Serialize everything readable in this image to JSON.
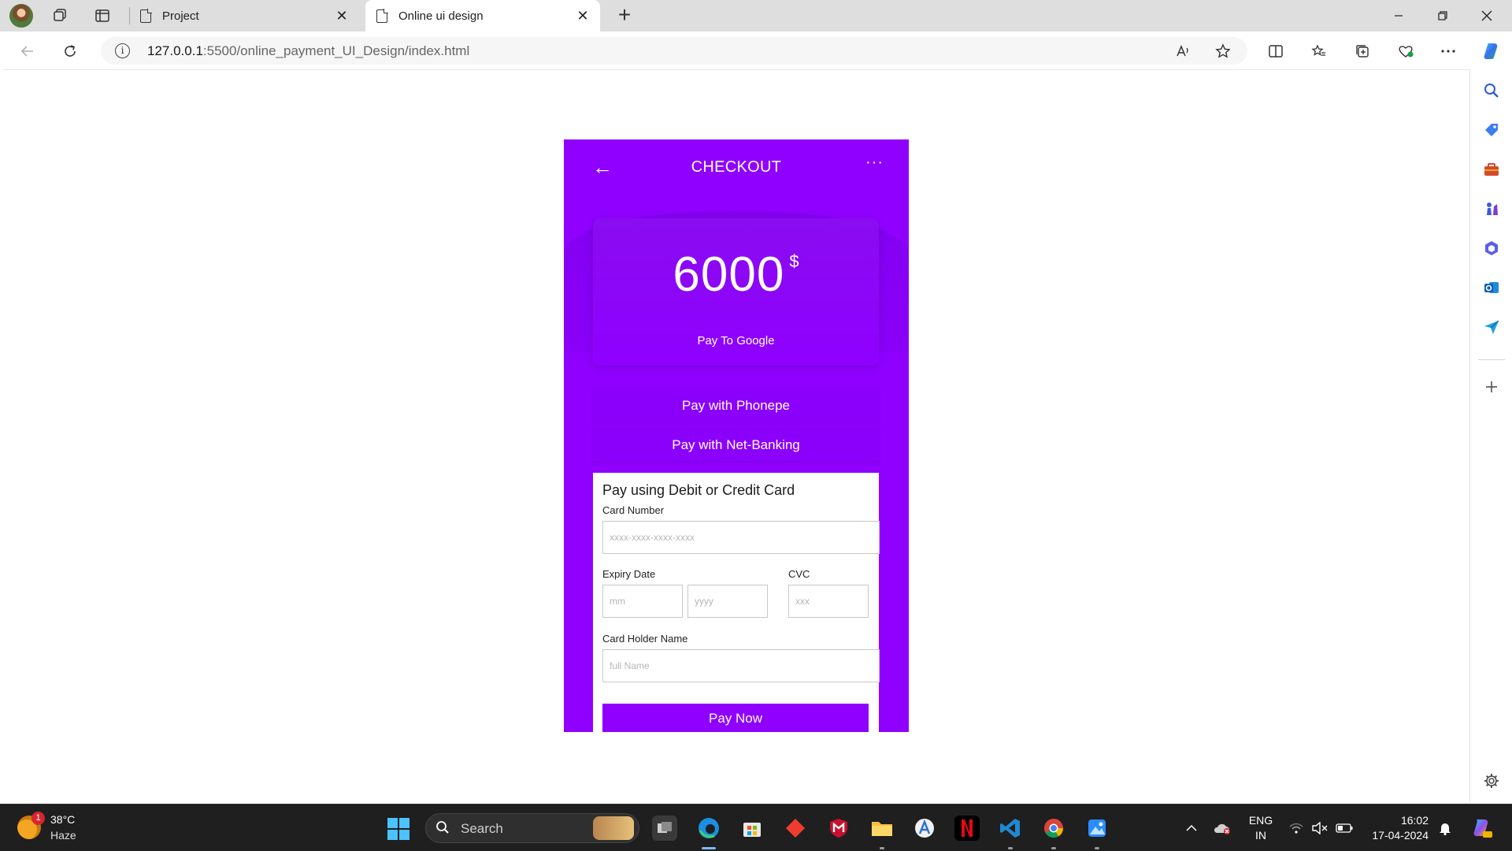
{
  "browser": {
    "tabs": [
      {
        "title": "Project"
      },
      {
        "title": "Online ui design"
      }
    ],
    "tab_close_glyph": "✕",
    "new_tab_glyph": "+",
    "address": {
      "url_host": "127.0.0.1",
      "url_rest": ":5500/online_payment_UI_Design/index.html"
    },
    "icons": {
      "back": "arrow-left-icon",
      "refresh": "refresh-icon",
      "read_aloud": "read-aloud-icon",
      "favorite": "star-icon",
      "split_screen": "split-screen-icon",
      "favorites": "favorites-icon",
      "collections": "collections-icon",
      "browser_essentials": "heart-pulse-icon",
      "settings_more": "more-icon",
      "copilot": "copilot-icon"
    }
  },
  "sidebar": {
    "icons": [
      "search-icon",
      "tag-icon",
      "toolbox-icon",
      "chess-icon",
      "office-icon",
      "outlook-icon",
      "send-icon",
      "plus-icon",
      "gear-icon"
    ]
  },
  "checkout": {
    "title": "CHECKOUT",
    "back_glyph": "←",
    "more_glyph": "···",
    "amount": "6000",
    "currency": "$",
    "payee": "Pay To Google",
    "options": [
      {
        "label": "Pay with Phonepe"
      },
      {
        "label": "Pay with Net-Banking"
      }
    ],
    "card_form": {
      "title": "Pay using Debit or Credit Card",
      "card_number_label": "Card Number",
      "card_number_placeholder": "xxxx-xxxx-xxxx-xxxx",
      "expiry_label": "Expiry Date",
      "month_placeholder": "mm",
      "year_placeholder": "yyyy",
      "cvc_label": "CVC",
      "cvc_placeholder": "xxx",
      "holder_label": "Card Holder Name",
      "holder_placeholder": "full Name",
      "submit_label": "Pay Now"
    },
    "colors": {
      "accent": "#8f00ff",
      "white": "#ffffff"
    }
  },
  "taskbar": {
    "weather": {
      "temp": "38°C",
      "desc": "Haze",
      "badge": "1"
    },
    "search_label": "Search",
    "lang_line1": "ENG",
    "lang_line2": "IN",
    "time": "16:02",
    "date": "17-04-2024",
    "apps": [
      "task-view-icon",
      "edge-icon",
      "store-icon",
      "git-icon",
      "mcafee-icon",
      "file-explorer-icon",
      "app-icon",
      "netflix-icon",
      "vscode-icon",
      "chrome-icon",
      "photos-icon"
    ]
  }
}
